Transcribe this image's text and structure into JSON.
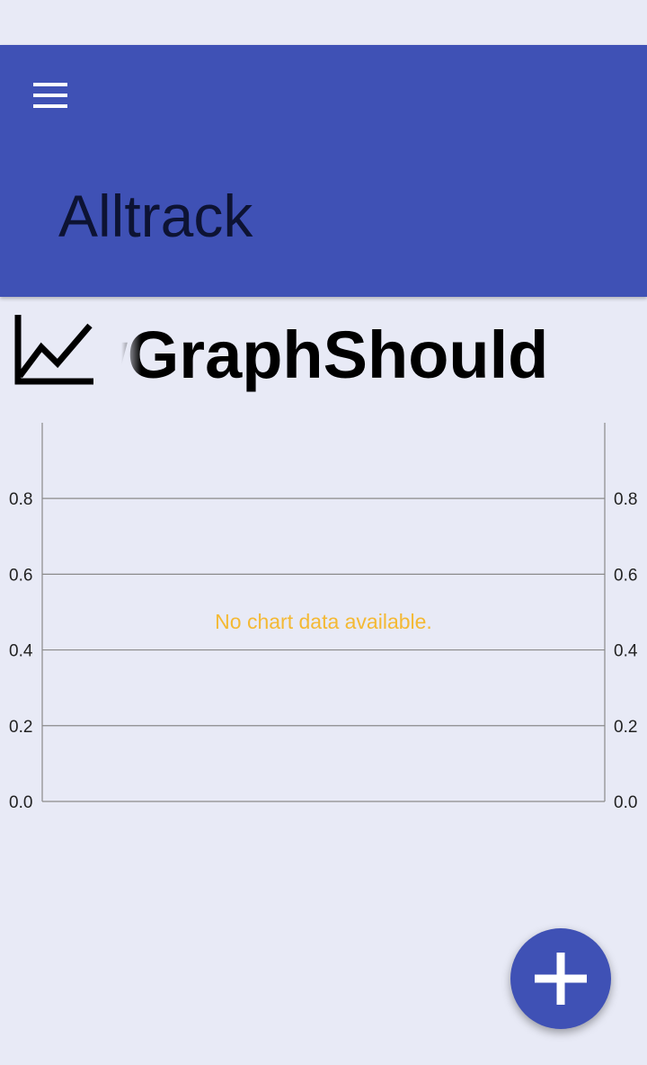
{
  "app_bar": {
    "title": "Alltrack",
    "menu_icon": "hamburger-menu-icon",
    "background_color": "#3f51b5"
  },
  "graph_header": {
    "icon": "line-chart-icon",
    "title": "ewGraphShould"
  },
  "chart_data": {
    "type": "line",
    "series": [],
    "y_left_ticks": [
      "0.8",
      "0.6",
      "0.4",
      "0.2",
      "0.0"
    ],
    "y_right_ticks": [
      "0.8",
      "0.6",
      "0.4",
      "0.2",
      "0.0"
    ],
    "ylim": [
      0,
      1
    ],
    "grid": true,
    "empty_message": "No chart data available.",
    "empty_message_color": "#f4b934"
  },
  "fab": {
    "icon": "plus-icon",
    "color": "#3f51b5"
  }
}
